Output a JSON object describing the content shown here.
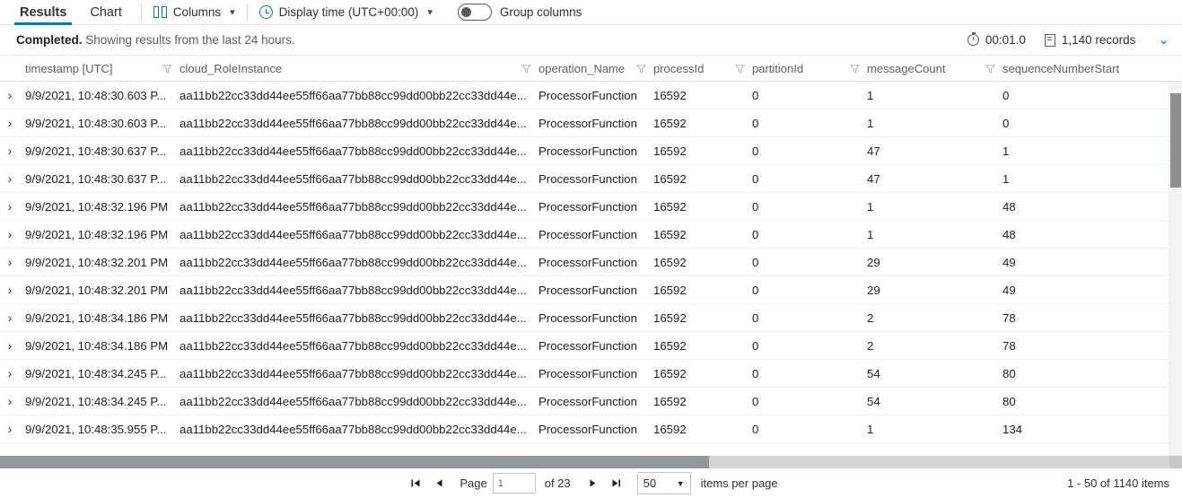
{
  "toolbar": {
    "tabs": [
      {
        "label": "Results",
        "active": true
      },
      {
        "label": "Chart",
        "active": false
      }
    ],
    "columns_label": "Columns",
    "display_time_label": "Display time (UTC+00:00)",
    "group_columns_label": "Group columns",
    "group_columns_on": false,
    "accent_color": "#0078d4"
  },
  "status": {
    "state": "Completed.",
    "message": "Showing results from the last 24 hours.",
    "duration": "00:01.0",
    "records": "1,140 records"
  },
  "grid": {
    "columns": [
      {
        "key": "timestamp",
        "label": "timestamp [UTC]"
      },
      {
        "key": "cloud_RoleInstance",
        "label": "cloud_RoleInstance"
      },
      {
        "key": "operation_Name",
        "label": "operation_Name"
      },
      {
        "key": "processId",
        "label": "processId"
      },
      {
        "key": "partitionId",
        "label": "partitionId"
      },
      {
        "key": "messageCount",
        "label": "messageCount"
      },
      {
        "key": "sequenceNumberStart",
        "label": "sequenceNumberStart"
      }
    ],
    "rows": [
      {
        "timestamp": "9/9/2021, 10:48:30.603 P...",
        "cloud_RoleInstance": "aa11bb22cc33dd44ee55ff66aa77bb88cc99dd00bb22cc33dd44e...",
        "operation_Name": "ProcessorFunction",
        "processId": "16592",
        "partitionId": "0",
        "messageCount": "1",
        "sequenceNumberStart": "0"
      },
      {
        "timestamp": "9/9/2021, 10:48:30.603 P...",
        "cloud_RoleInstance": "aa11bb22cc33dd44ee55ff66aa77bb88cc99dd00bb22cc33dd44e...",
        "operation_Name": "ProcessorFunction",
        "processId": "16592",
        "partitionId": "0",
        "messageCount": "1",
        "sequenceNumberStart": "0"
      },
      {
        "timestamp": "9/9/2021, 10:48:30.637 P...",
        "cloud_RoleInstance": "aa11bb22cc33dd44ee55ff66aa77bb88cc99dd00bb22cc33dd44e...",
        "operation_Name": "ProcessorFunction",
        "processId": "16592",
        "partitionId": "0",
        "messageCount": "47",
        "sequenceNumberStart": "1"
      },
      {
        "timestamp": "9/9/2021, 10:48:30.637 P...",
        "cloud_RoleInstance": "aa11bb22cc33dd44ee55ff66aa77bb88cc99dd00bb22cc33dd44e...",
        "operation_Name": "ProcessorFunction",
        "processId": "16592",
        "partitionId": "0",
        "messageCount": "47",
        "sequenceNumberStart": "1"
      },
      {
        "timestamp": "9/9/2021, 10:48:32.196 PM",
        "cloud_RoleInstance": "aa11bb22cc33dd44ee55ff66aa77bb88cc99dd00bb22cc33dd44e...",
        "operation_Name": "ProcessorFunction",
        "processId": "16592",
        "partitionId": "0",
        "messageCount": "1",
        "sequenceNumberStart": "48"
      },
      {
        "timestamp": "9/9/2021, 10:48:32.196 PM",
        "cloud_RoleInstance": "aa11bb22cc33dd44ee55ff66aa77bb88cc99dd00bb22cc33dd44e...",
        "operation_Name": "ProcessorFunction",
        "processId": "16592",
        "partitionId": "0",
        "messageCount": "1",
        "sequenceNumberStart": "48"
      },
      {
        "timestamp": "9/9/2021, 10:48:32.201 PM",
        "cloud_RoleInstance": "aa11bb22cc33dd44ee55ff66aa77bb88cc99dd00bb22cc33dd44e...",
        "operation_Name": "ProcessorFunction",
        "processId": "16592",
        "partitionId": "0",
        "messageCount": "29",
        "sequenceNumberStart": "49"
      },
      {
        "timestamp": "9/9/2021, 10:48:32.201 PM",
        "cloud_RoleInstance": "aa11bb22cc33dd44ee55ff66aa77bb88cc99dd00bb22cc33dd44e...",
        "operation_Name": "ProcessorFunction",
        "processId": "16592",
        "partitionId": "0",
        "messageCount": "29",
        "sequenceNumberStart": "49"
      },
      {
        "timestamp": "9/9/2021, 10:48:34.186 PM",
        "cloud_RoleInstance": "aa11bb22cc33dd44ee55ff66aa77bb88cc99dd00bb22cc33dd44e...",
        "operation_Name": "ProcessorFunction",
        "processId": "16592",
        "partitionId": "0",
        "messageCount": "2",
        "sequenceNumberStart": "78"
      },
      {
        "timestamp": "9/9/2021, 10:48:34.186 PM",
        "cloud_RoleInstance": "aa11bb22cc33dd44ee55ff66aa77bb88cc99dd00bb22cc33dd44e...",
        "operation_Name": "ProcessorFunction",
        "processId": "16592",
        "partitionId": "0",
        "messageCount": "2",
        "sequenceNumberStart": "78"
      },
      {
        "timestamp": "9/9/2021, 10:48:34.245 P...",
        "cloud_RoleInstance": "aa11bb22cc33dd44ee55ff66aa77bb88cc99dd00bb22cc33dd44e...",
        "operation_Name": "ProcessorFunction",
        "processId": "16592",
        "partitionId": "0",
        "messageCount": "54",
        "sequenceNumberStart": "80"
      },
      {
        "timestamp": "9/9/2021, 10:48:34.245 P...",
        "cloud_RoleInstance": "aa11bb22cc33dd44ee55ff66aa77bb88cc99dd00bb22cc33dd44e...",
        "operation_Name": "ProcessorFunction",
        "processId": "16592",
        "partitionId": "0",
        "messageCount": "54",
        "sequenceNumberStart": "80"
      },
      {
        "timestamp": "9/9/2021, 10:48:35.955 P...",
        "cloud_RoleInstance": "aa11bb22cc33dd44ee55ff66aa77bb88cc99dd00bb22cc33dd44e...",
        "operation_Name": "ProcessorFunction",
        "processId": "16592",
        "partitionId": "0",
        "messageCount": "1",
        "sequenceNumberStart": "134"
      }
    ]
  },
  "pager": {
    "first_label": "⏮",
    "prev_label": "◀",
    "page_label": "Page",
    "page_value": "1",
    "of_label": "of 23",
    "next_label": "▶",
    "last_label": "⏭",
    "page_size": "50",
    "items_per_page_label": "items per page",
    "range_label": "1 - 50 of 1140 items"
  }
}
